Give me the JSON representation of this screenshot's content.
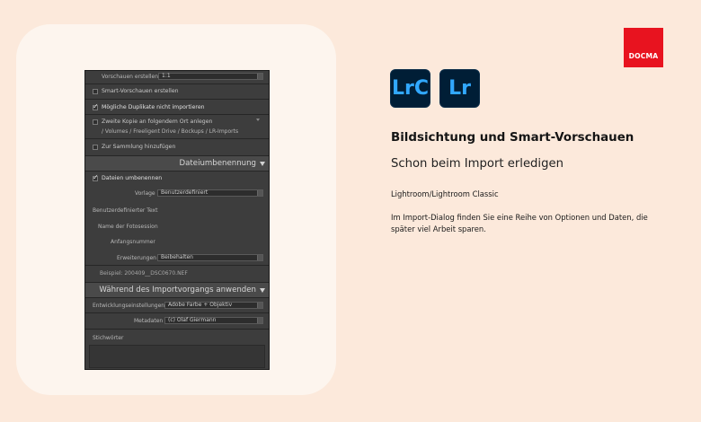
{
  "brand": {
    "logo_text": "DOCMA",
    "color": "#e8131f"
  },
  "apps": [
    {
      "label": "LrC",
      "icon": "lightroom-classic-icon"
    },
    {
      "label": "Lr",
      "icon": "lightroom-icon"
    }
  ],
  "article": {
    "title": "Bildsichtung und Smart-Vorschauen",
    "subtitle": "Schon beim Import erledigen",
    "category": "Lightroom/Lightroom Classic",
    "description": "Im Import-Dialog finden Sie eine Reihe von Optionen und Daten, die später viel Arbeit sparen."
  },
  "panel": {
    "preview_label": "Vorschauen erstellen",
    "preview_value": "1:1",
    "smart_preview": "Smart-Vorschauen erstellen",
    "duplicates": "Mögliche Duplikate nicht importieren",
    "second_copy": "Zweite Kopie an folgendem Ort anlegen",
    "second_copy_path": "/ Volumes / Freeligent Drive / Bockups / LR-Imports",
    "collection": "Zur Sammlung hinzufügen",
    "rename_section": "Dateiumbenennung",
    "rename_files": "Dateien umbenennen",
    "template_label": "Vorlage",
    "template_value": "Benutzerdefiniert",
    "custom_text": "Benutzerdefinierter Text",
    "shoot_name": "Name der Fotosession",
    "start_number": "Anfangsnummer",
    "extensions_label": "Erweiterungen",
    "extensions_value": "Beibehalten",
    "example": "Beispiel:  200409__DSC0670.NEF",
    "apply_section": "Während des Importvorgangs anwenden",
    "dev_label": "Entwicklungseinstellungen",
    "dev_value": "Adobe Farbe + Objektiv",
    "meta_label": "Metadaten",
    "meta_value": "(c) Olaf Giermann",
    "keywords": "Stichwörter"
  }
}
